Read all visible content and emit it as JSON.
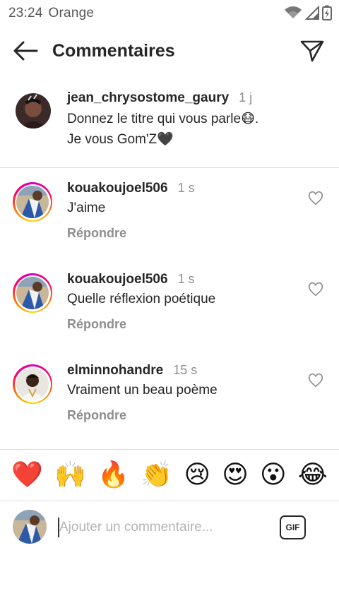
{
  "status_bar": {
    "time": "23:24",
    "carrier": "Orange",
    "icons": [
      "wifi-icon",
      "signal-icon",
      "battery-charging-icon"
    ]
  },
  "header": {
    "title": "Commentaires",
    "back_icon": "arrow-left-icon",
    "send_icon": "paper-plane-icon"
  },
  "caption": {
    "username": "jean_chrysostome_gaury",
    "time": "1 j",
    "line1": "Donnez le titre qui vous parle😷.",
    "line2": "Je vous Gom'Z🖤"
  },
  "comments": [
    {
      "username": "kouakoujoel506",
      "time": "1 s",
      "text": "J'aime",
      "reply_label": "Répondre"
    },
    {
      "username": "kouakoujoel506",
      "time": "1 s",
      "text": "Quelle réflexion poétique",
      "reply_label": "Répondre"
    },
    {
      "username": "elminnohandre",
      "time": "15 s",
      "text": "Vraiment un beau poème",
      "reply_label": "Répondre"
    }
  ],
  "emoji_bar": [
    "❤️",
    "🙌",
    "🔥",
    "👏",
    "😢",
    "😍",
    "😮",
    "😂"
  ],
  "composer": {
    "placeholder": "Ajouter un commentaire...",
    "gif_label": "GIF"
  },
  "colors": {
    "text": "#262626",
    "muted": "#8e8e8e",
    "divider": "#dbdbdb",
    "story_ring": [
      "#d300c5",
      "#ff0069",
      "#ff7a00",
      "#ffd600"
    ]
  }
}
